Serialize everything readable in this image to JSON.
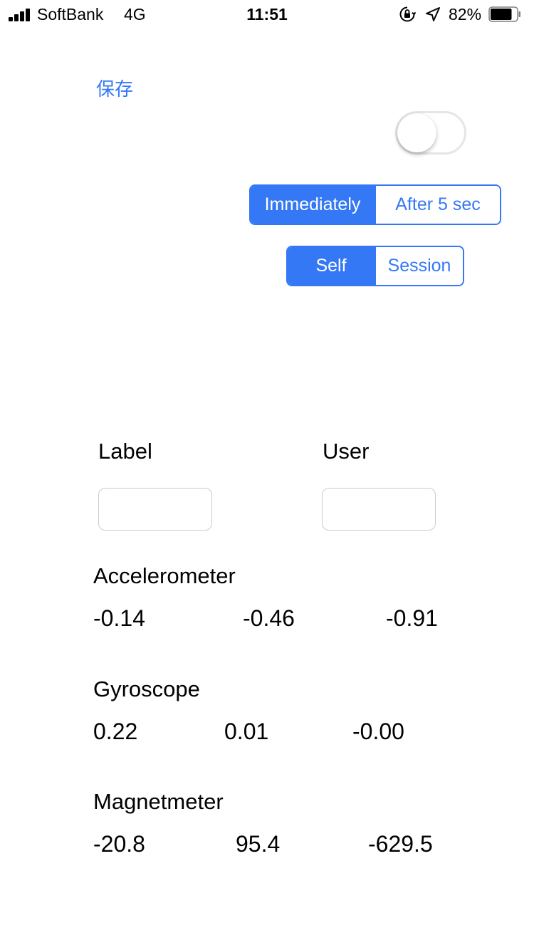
{
  "status_bar": {
    "carrier": "SoftBank",
    "network": "4G",
    "time": "11:51",
    "battery_percent": "82%",
    "battery_level": 0.82
  },
  "toolbar": {
    "save_label": "保存"
  },
  "toggle": {
    "on": false
  },
  "timing_control": {
    "options": [
      "Immediately",
      "After 5 sec"
    ],
    "selected_index": 0
  },
  "scope_control": {
    "options": [
      "Self",
      "Session"
    ],
    "selected_index": 0
  },
  "form": {
    "label_title": "Label",
    "label_value": "",
    "user_title": "User",
    "user_value": ""
  },
  "sensors": {
    "accelerometer": {
      "title": "Accelerometer",
      "values": [
        "-0.14",
        "-0.46",
        "-0.91"
      ]
    },
    "gyroscope": {
      "title": "Gyroscope",
      "values": [
        "0.22",
        "0.01",
        "-0.00"
      ]
    },
    "magnetometer": {
      "title": "Magnetmeter",
      "values": [
        "-20.8",
        "95.4",
        "-629.5"
      ]
    }
  },
  "colors": {
    "accent": "#3478f6",
    "toggle_border": "#e5e5ea",
    "field_border": "#cccccc"
  }
}
